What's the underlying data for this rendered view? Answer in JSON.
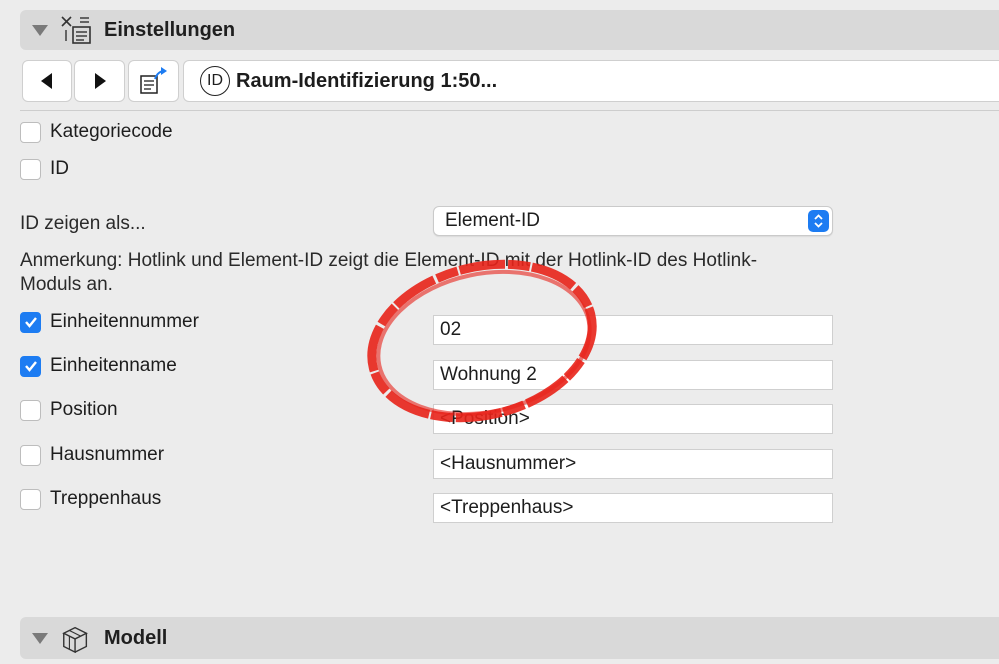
{
  "settings_section": {
    "title": "Einstellungen",
    "icon": "settings-panel-icon"
  },
  "nav": {
    "back_icon": "triangle-left-icon",
    "forward_icon": "triangle-right-icon",
    "transfer_icon": "transfer-settings-icon",
    "preset_icon_text": "ID",
    "preset_label": "Raum-Identifizierung 1:50..."
  },
  "checkboxes_top": [
    {
      "label": "Kategoriecode",
      "checked": false
    },
    {
      "label": "ID",
      "checked": false
    }
  ],
  "id_display": {
    "label": "ID zeigen als...",
    "value": "Element-ID"
  },
  "note": "Anmerkung: Hotlink und Element-ID zeigt die Element-ID mit der Hotlink-ID des Hotlink-Moduls an.",
  "fields": [
    {
      "label": "Einheitennummer",
      "checked": true,
      "value": "02"
    },
    {
      "label": "Einheitenname",
      "checked": true,
      "value": "Wohnung 2"
    },
    {
      "label": "Position",
      "checked": false,
      "value": "<Position>"
    },
    {
      "label": "Hausnummer",
      "checked": false,
      "value": "<Hausnummer>"
    },
    {
      "label": "Treppenhaus",
      "checked": false,
      "value": "<Treppenhaus>"
    }
  ],
  "model_section": {
    "title": "Modell",
    "icon": "model-box-icon"
  },
  "colors": {
    "accent": "#1d7cf2",
    "annotation": "#e8231a"
  }
}
